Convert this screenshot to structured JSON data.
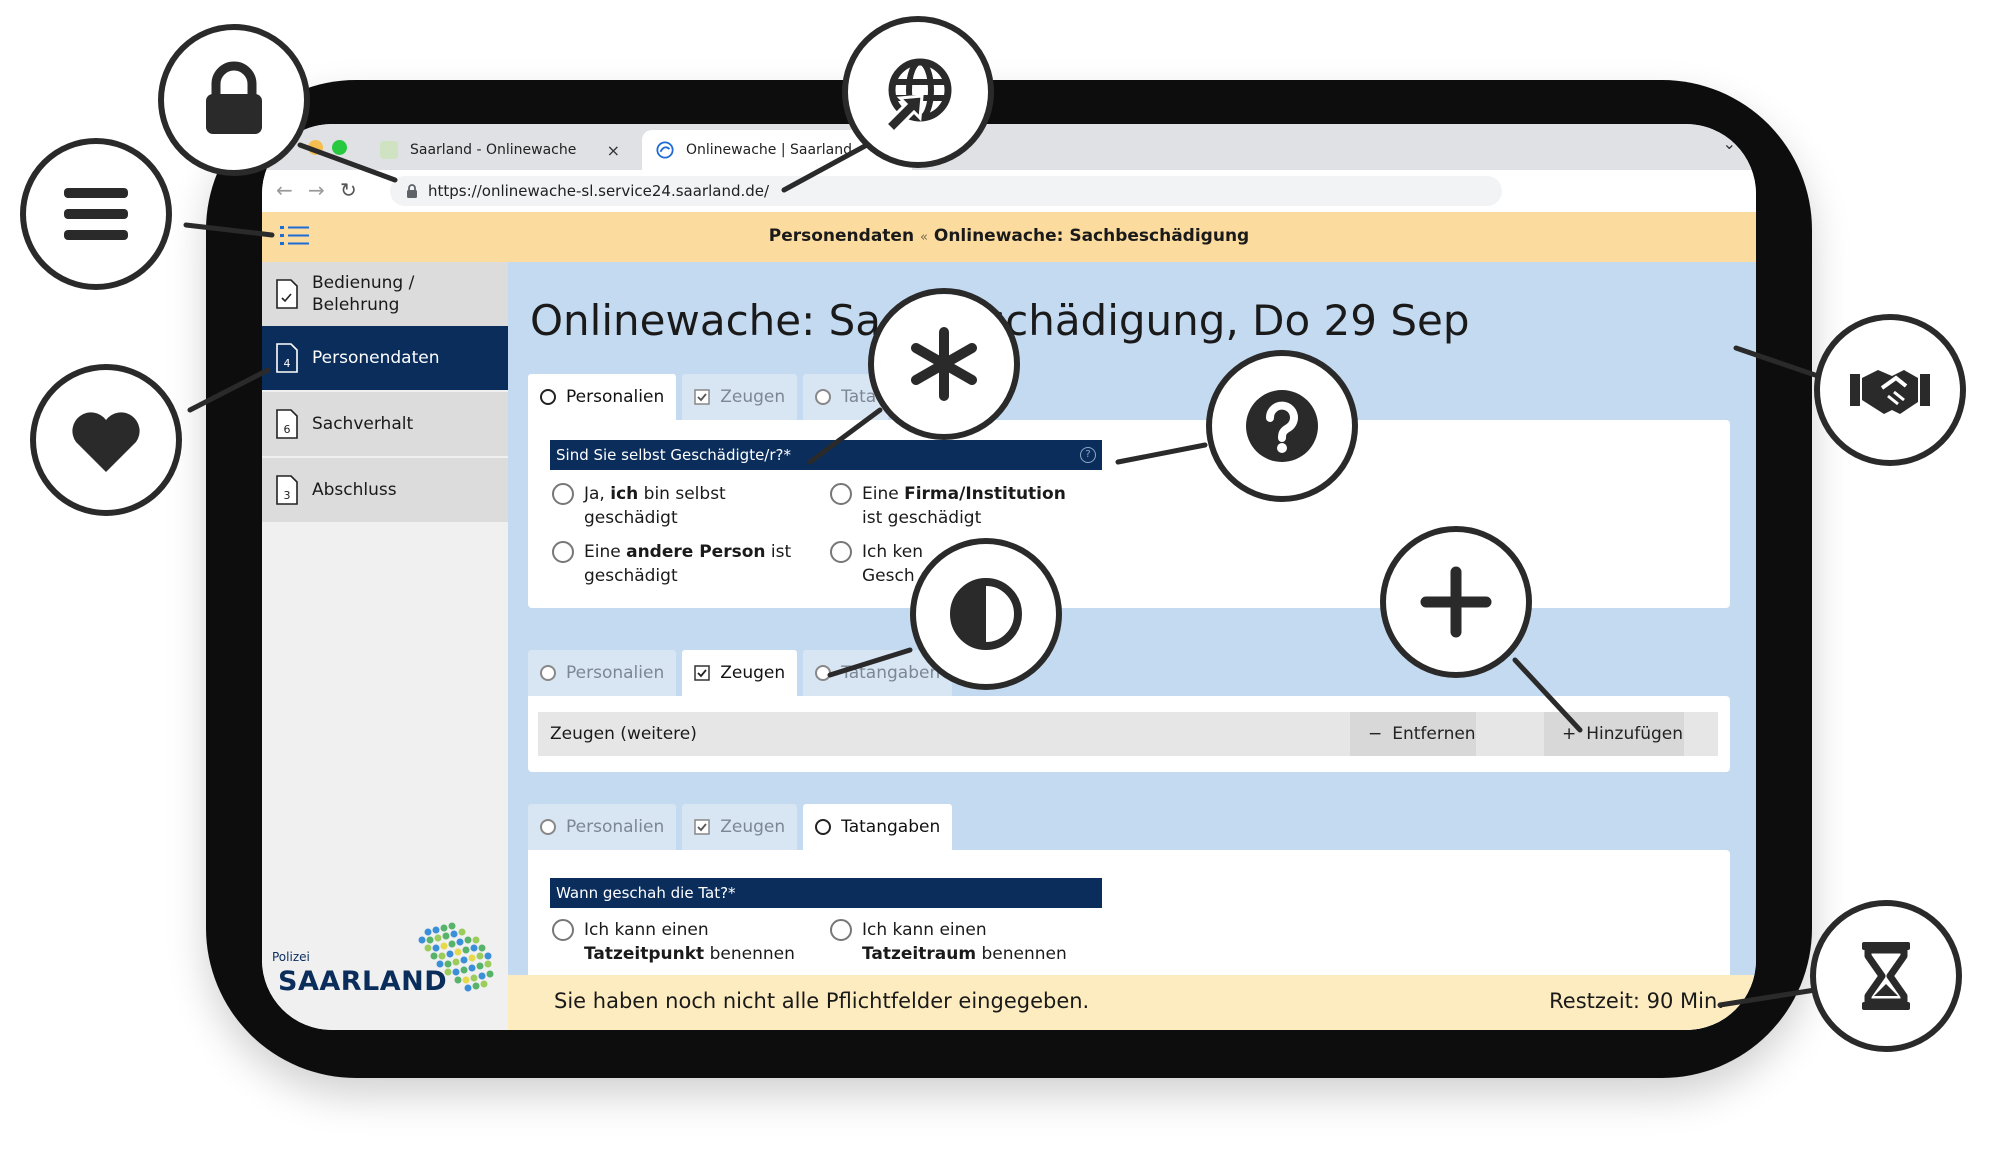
{
  "browser": {
    "tabs": [
      {
        "title": "Saarland - Onlinewache",
        "active": false
      },
      {
        "title": "Onlinewache | Saarland",
        "active": true
      }
    ],
    "tab_close": "×",
    "url": "https://onlinewache-sl.service24.saarland.de/"
  },
  "header": {
    "section": "Personendaten",
    "separator": "«",
    "page": "Onlinewache: Sachbeschädigung"
  },
  "sidebar": {
    "items": [
      {
        "number": "",
        "label_line1": "Bedienung /",
        "label_line2": "Belehrung",
        "active": false
      },
      {
        "number": "4",
        "label_line1": "Personendaten",
        "label_line2": "",
        "active": true
      },
      {
        "number": "6",
        "label_line1": "Sachverhalt",
        "label_line2": "",
        "active": false
      },
      {
        "number": "3",
        "label_line1": "Abschluss",
        "label_line2": "",
        "active": false
      }
    ],
    "logo_small": "Polizei",
    "logo_main": "SAARLAND"
  },
  "main": {
    "title": "Onlinewache: Sachbeschädigung,  Do 29 Sep",
    "section1": {
      "tabs": [
        "Personalien",
        "Zeugen",
        "Tatangaben"
      ],
      "tab3_visible": "Tata",
      "question": "Sind Sie selbst Geschädigte/r?*",
      "options": [
        {
          "pre": "Ja, ",
          "bold": "ich",
          "post": " bin selbst",
          "line2": "geschädigt"
        },
        {
          "pre": "Eine ",
          "bold": "Firma/Institution",
          "post": "",
          "line2": "ist geschädigt"
        },
        {
          "pre": "Eine ",
          "bold": "andere Person",
          "post": " ist",
          "line2": "geschädigt"
        },
        {
          "pre": "Ich ken",
          "bold": "",
          "post": "",
          "line2": "Gesch"
        }
      ]
    },
    "section2": {
      "tabs": [
        "Personalien",
        "Zeugen",
        "Tatangaben"
      ],
      "row_label": "Zeugen (weitere)",
      "remove_label": "Entfernen",
      "add_label": "Hinzufügen"
    },
    "section3": {
      "tabs": [
        "Personalien",
        "Zeugen",
        "Tatangaben"
      ],
      "question": "Wann geschah die Tat?*",
      "options": [
        {
          "line1": "Ich kann einen",
          "bold": "Tatzeitpunkt",
          "post": " benennen"
        },
        {
          "line1": "Ich kann einen",
          "bold": "Tatzeitraum",
          "post": " benennen"
        }
      ]
    }
  },
  "footer": {
    "message": "Sie haben noch nicht alle Pflichtfelder eingegeben.",
    "time_left": "Restzeit: 90 Min."
  },
  "callouts": [
    {
      "icon": "lock-icon"
    },
    {
      "icon": "globe-icon"
    },
    {
      "icon": "menu-icon"
    },
    {
      "icon": "heart-icon"
    },
    {
      "icon": "asterisk-icon"
    },
    {
      "icon": "question-icon"
    },
    {
      "icon": "contrast-icon"
    },
    {
      "icon": "plus-icon"
    },
    {
      "icon": "handshake-icon"
    },
    {
      "icon": "hourglass-icon"
    }
  ],
  "colors": {
    "navy": "#0a2d5c",
    "header_yellow": "#fcdc9e",
    "main_blue": "#c4daf1",
    "footer_yellow": "#fdecc0"
  }
}
